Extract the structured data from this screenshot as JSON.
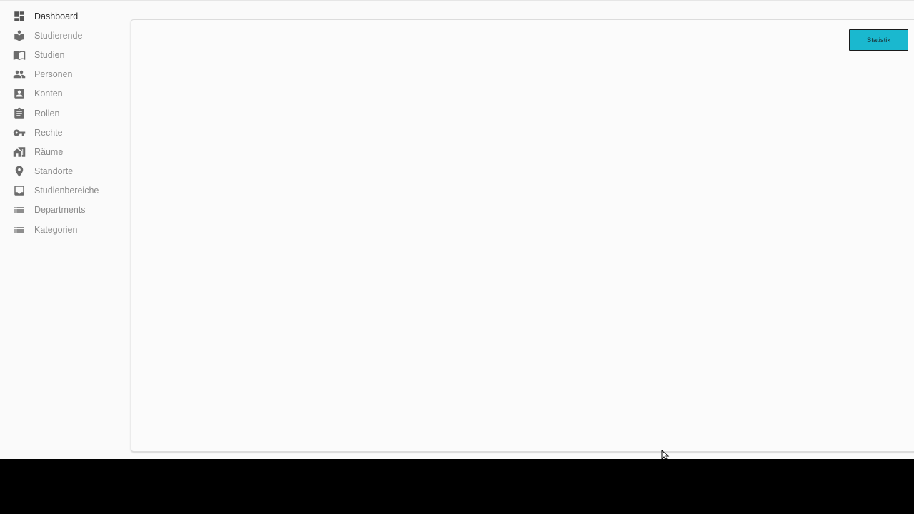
{
  "sidebar": {
    "items": [
      {
        "label": "Dashboard",
        "icon": "dashboard-icon",
        "active": true
      },
      {
        "label": "Studierende",
        "icon": "student-icon",
        "active": false
      },
      {
        "label": "Studien",
        "icon": "book-icon",
        "active": false
      },
      {
        "label": "Personen",
        "icon": "people-icon",
        "active": false
      },
      {
        "label": "Konten",
        "icon": "account-box-icon",
        "active": false
      },
      {
        "label": "Rollen",
        "icon": "clipboard-icon",
        "active": false
      },
      {
        "label": "Rechte",
        "icon": "key-icon",
        "active": false
      },
      {
        "label": "Räume",
        "icon": "building-icon",
        "active": false
      },
      {
        "label": "Standorte",
        "icon": "location-pin-icon",
        "active": false
      },
      {
        "label": "Studienbereiche",
        "icon": "inbox-icon",
        "active": false
      },
      {
        "label": "Departments",
        "icon": "list-icon",
        "active": false
      },
      {
        "label": "Kategorien",
        "icon": "list-icon",
        "active": false
      }
    ]
  },
  "main": {
    "statistik_label": "Statistik"
  },
  "colors": {
    "accent": "#1ab8cf",
    "sidebar_icon": "#6b6b6b",
    "sidebar_text": "#8a8a8a",
    "active_text": "#2b2b2b",
    "background": "#fafafa"
  }
}
